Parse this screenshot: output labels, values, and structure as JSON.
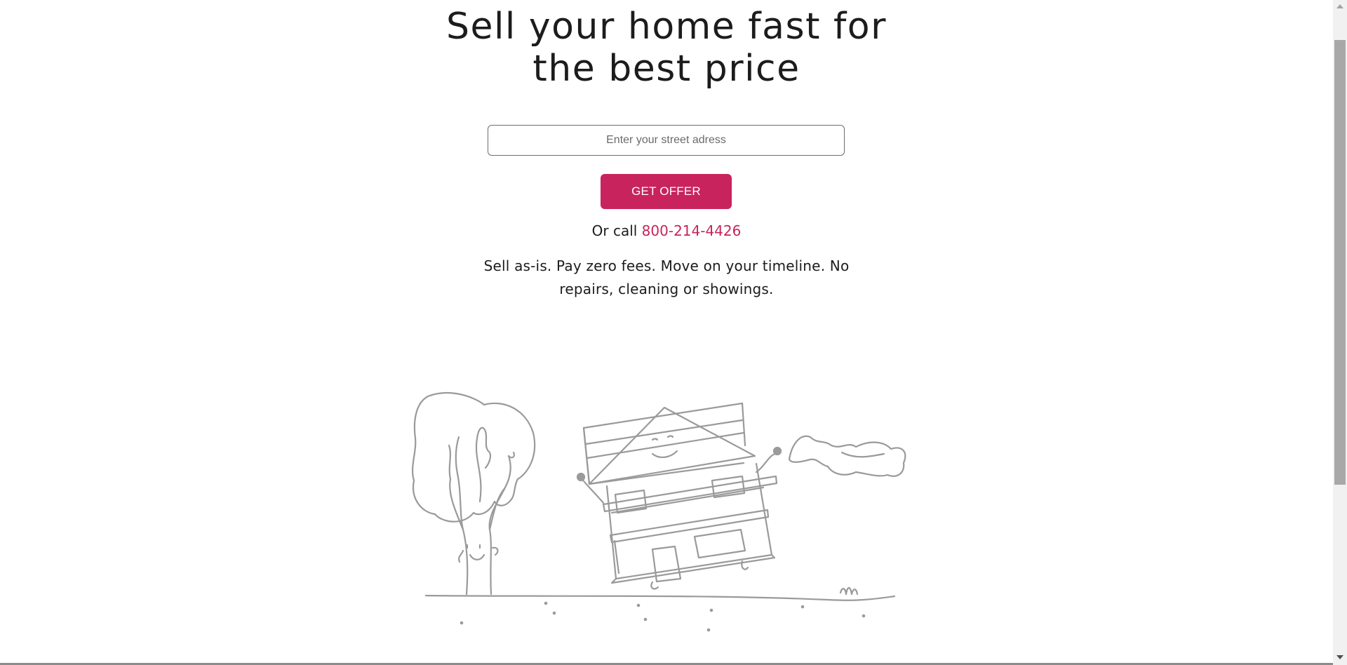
{
  "hero": {
    "title_line1": "Sell your home fast for",
    "title_line2": "the best price"
  },
  "address_form": {
    "placeholder": "Enter your street adress",
    "value": "",
    "submit_label": "GET OFFER"
  },
  "contact": {
    "prefix": "Or call",
    "phone": "800-214-4426"
  },
  "pitch": {
    "text": "Sell as-is. Pay zero fees. Move on your timeline. No repairs, cleaning or showings."
  },
  "illustration": {
    "name": "house-illustration",
    "elements": [
      "tree",
      "walking-house",
      "cloud",
      "grass",
      "ground-line"
    ]
  },
  "colors": {
    "accent": "#c8235c",
    "text": "#1c1c1c",
    "sketch": "#9a9a9a",
    "background": "#ffffff"
  }
}
